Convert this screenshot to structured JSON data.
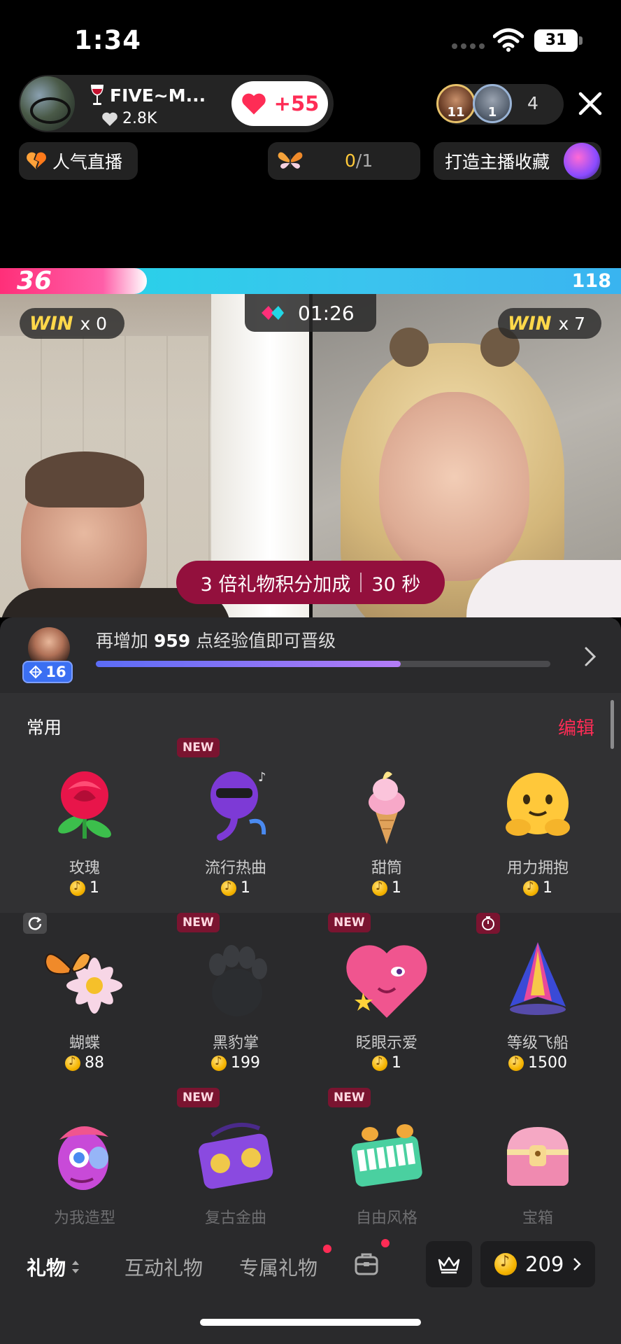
{
  "status": {
    "time": "1:34",
    "battery": "31"
  },
  "host": {
    "name": "FIVE~M...",
    "likes": "2.8K",
    "follow_plus": "+55"
  },
  "viewers": {
    "avatar1_badge": "11",
    "avatar2_badge": "1",
    "count": "4"
  },
  "chips": {
    "popular": "人气直播",
    "task_current": "0",
    "task_total": "/1",
    "collect": "打造主播收藏"
  },
  "battle": {
    "left_score": "36",
    "right_score": "118",
    "timer": "01:26",
    "left_win_word": "WIN",
    "left_win_count": "x 0",
    "right_win_word": "WIN",
    "right_win_count": "x 7",
    "boost_text": "3 倍礼物积分加成",
    "boost_time": "30 秒"
  },
  "level": {
    "badge": "16",
    "text_prefix": "再增加",
    "points": "959",
    "text_suffix": "点经验值即可晋级",
    "progress": 0.67
  },
  "gift_panel": {
    "section_title": "常用",
    "edit_label": "编辑",
    "new_tag": "NEW",
    "gifts": [
      {
        "name": "玫瑰",
        "price": "1"
      },
      {
        "name": "流行热曲",
        "price": "1"
      },
      {
        "name": "甜筒",
        "price": "1"
      },
      {
        "name": "用力拥抱",
        "price": "1"
      },
      {
        "name": "蝴蝶",
        "price": "88"
      },
      {
        "name": "黑豹掌",
        "price": "199"
      },
      {
        "name": "眨眼示爱",
        "price": "1"
      },
      {
        "name": "等级飞船",
        "price": "1500"
      },
      {
        "name": "为我造型"
      },
      {
        "name": "复古金曲"
      },
      {
        "name": "自由风格"
      },
      {
        "name": "宝箱"
      }
    ]
  },
  "tabs": {
    "gift": "礼物",
    "interactive": "互动礼物",
    "exclusive": "专属礼物"
  },
  "wallet": {
    "coins": "209"
  },
  "colors": {
    "accent": "#fe2c55",
    "boost": "#93103d",
    "level_badge": "#3b6ff2"
  }
}
